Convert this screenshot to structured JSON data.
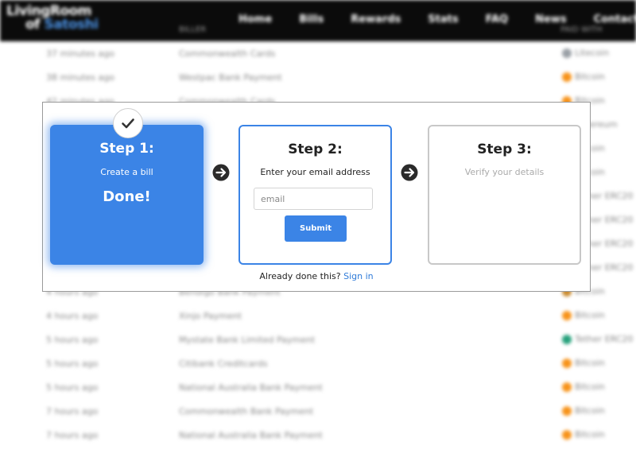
{
  "header": {
    "logo_line1": "LivingRoom",
    "logo_line2_prefix": "of",
    "logo_line2_accent": "Satoshi",
    "nav": [
      "Home",
      "Bills",
      "Rewards",
      "Stats",
      "FAQ",
      "News",
      "Contact"
    ]
  },
  "feed": {
    "col_biller": "BILLER",
    "col_paid_with": "PAID WITH",
    "rows": [
      {
        "time": "37 minutes ago",
        "desc": "Commonwealth Cards",
        "coin": "Litecoin",
        "color": "#9aa0a6"
      },
      {
        "time": "38 minutes ago",
        "desc": "Westpac Bank Payment",
        "coin": "Bitcoin",
        "color": "#f7931a"
      },
      {
        "time": "42 minutes ago",
        "desc": "Commonwealth Cards",
        "coin": "Bitcoin",
        "color": "#f7931a"
      },
      {
        "time": "",
        "desc": "",
        "coin": "Ethereum",
        "color": "#8c8c8c"
      },
      {
        "time": "",
        "desc": "",
        "coin": "Bitcoin",
        "color": "#f7931a"
      },
      {
        "time": "",
        "desc": "",
        "coin": "Bitcoin",
        "color": "#f7931a"
      },
      {
        "time": "",
        "desc": "",
        "coin": "Tether ERC20",
        "color": "#26a17b"
      },
      {
        "time": "",
        "desc": "",
        "coin": "Tether ERC20",
        "color": "#26a17b"
      },
      {
        "time": "",
        "desc": "",
        "coin": "Tether ERC20",
        "color": "#26a17b"
      },
      {
        "time": "",
        "desc": "",
        "coin": "Tether ERC20",
        "color": "#26a17b"
      },
      {
        "time": "4 hours ago",
        "desc": "Bendigo Bank Payment",
        "coin": "Bitcoin",
        "color": "#c98a2e"
      },
      {
        "time": "4 hours ago",
        "desc": "Xinjo Payment",
        "coin": "Bitcoin",
        "color": "#f7931a"
      },
      {
        "time": "5 hours ago",
        "desc": "Mystate Bank Limited Payment",
        "coin": "Tether ERC20",
        "color": "#26a17b"
      },
      {
        "time": "5 hours ago",
        "desc": "Citibank Creditcards",
        "coin": "Bitcoin",
        "color": "#f7931a"
      },
      {
        "time": "5 hours ago",
        "desc": "National Australia Bank Payment",
        "coin": "Bitcoin",
        "color": "#f7931a"
      },
      {
        "time": "7 hours ago",
        "desc": "Commonwealth Bank Payment",
        "coin": "Bitcoin",
        "color": "#f7931a"
      },
      {
        "time": "7 hours ago",
        "desc": "National Australia Bank Payment",
        "coin": "Bitcoin",
        "color": "#f7931a"
      }
    ]
  },
  "modal": {
    "step1": {
      "title": "Step 1:",
      "subtitle": "Create a bill",
      "status": "Done!"
    },
    "step2": {
      "title": "Step 2:",
      "subtitle": "Enter your email address",
      "email_placeholder": "email",
      "email_value": "",
      "submit_label": "Submit"
    },
    "step3": {
      "title": "Step 3:",
      "subtitle": "Verify your details"
    },
    "already_text": "Already done this?",
    "signin_label": "Sign in"
  },
  "colors": {
    "accent": "#3b84e6",
    "nav_bg": "#0b0b0b",
    "link": "#2f7bd8"
  },
  "icons": {
    "check": "check-icon",
    "arrow": "arrow-right-circle-icon",
    "coin": "coin-icon"
  }
}
